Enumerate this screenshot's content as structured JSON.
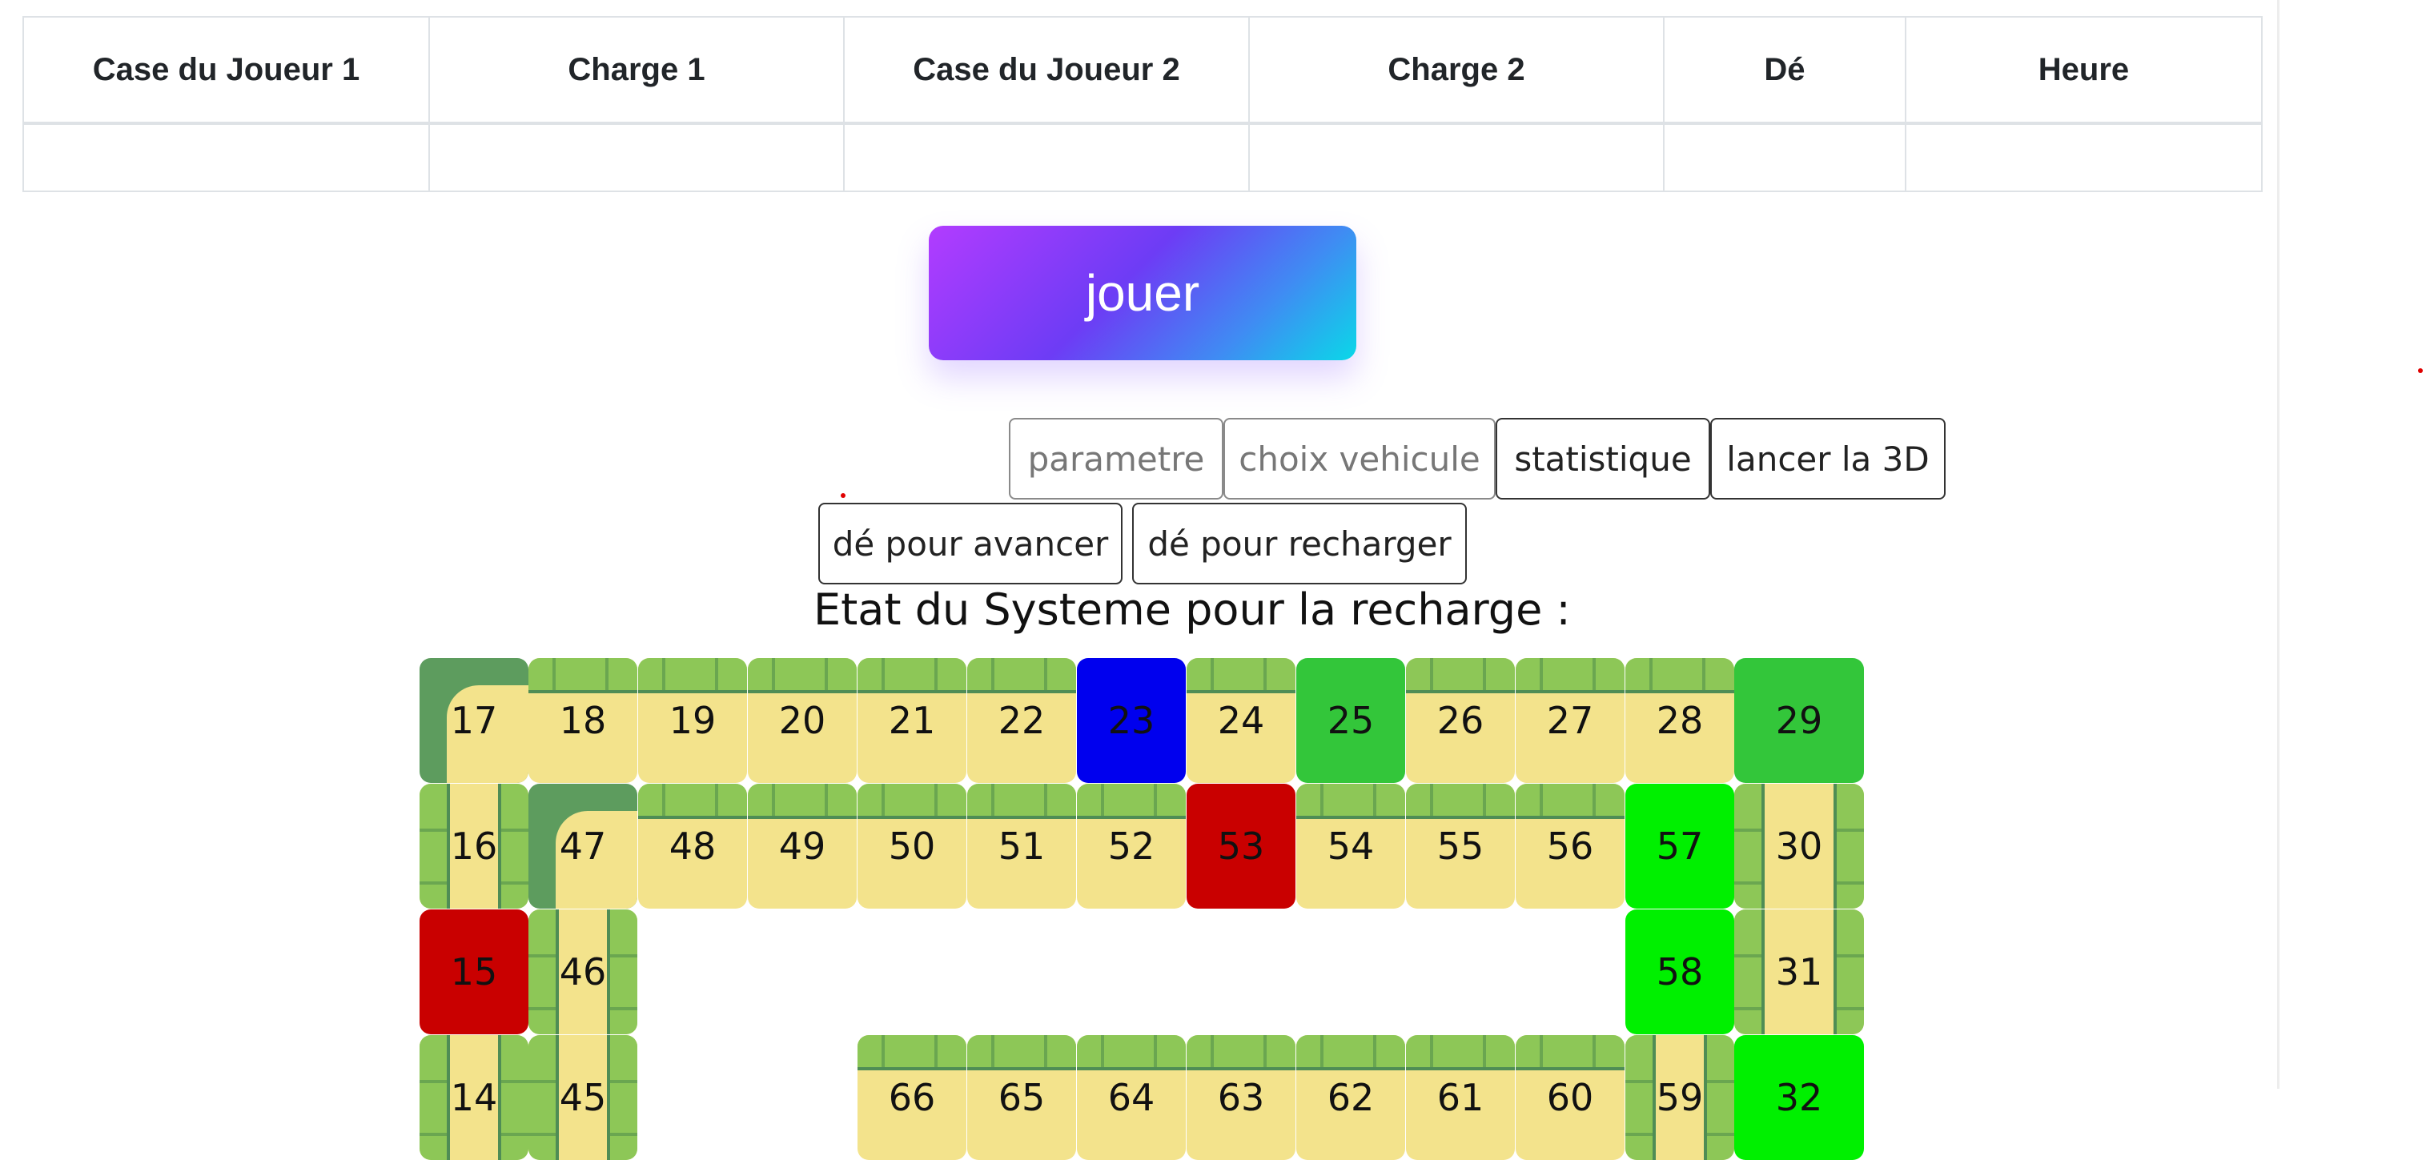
{
  "table": {
    "headers": [
      "Case du Joueur 1",
      "Charge 1",
      "Case du Joueur 2",
      "Charge 2",
      "Dé",
      "Heure"
    ],
    "rows": [
      [
        "",
        "",
        "",
        "",
        "",
        ""
      ]
    ]
  },
  "buttons": {
    "play": "jouer",
    "parametre": "parametre",
    "choix_vehicule": "choix vehicule",
    "statistique": "statistique",
    "lancer_3d": "lancer la 3D",
    "de_avancer": "dé pour avancer",
    "de_recharger": "dé pour recharger"
  },
  "system_state_label": "Etat du Systeme pour la recharge :",
  "board": {
    "row1": [
      "17",
      "18",
      "19",
      "20",
      "21",
      "22",
      "23",
      "24",
      "25",
      "26",
      "27",
      "28",
      "29"
    ],
    "row2": [
      "16",
      "47",
      "48",
      "49",
      "50",
      "51",
      "52",
      "53",
      "54",
      "55",
      "56",
      "57",
      "30"
    ],
    "row3": [
      "15",
      "46",
      "58",
      "31"
    ],
    "row4": [
      "14",
      "45",
      "66",
      "65",
      "64",
      "63",
      "62",
      "61",
      "60",
      "59",
      "32"
    ]
  },
  "colors": {
    "player_blue": "#0000ee",
    "charge_red": "#c90000",
    "charge_green": "#33c63a",
    "charge_lime": "#00f000",
    "path_sand": "#f3e38c",
    "grass": "#8dc757"
  }
}
